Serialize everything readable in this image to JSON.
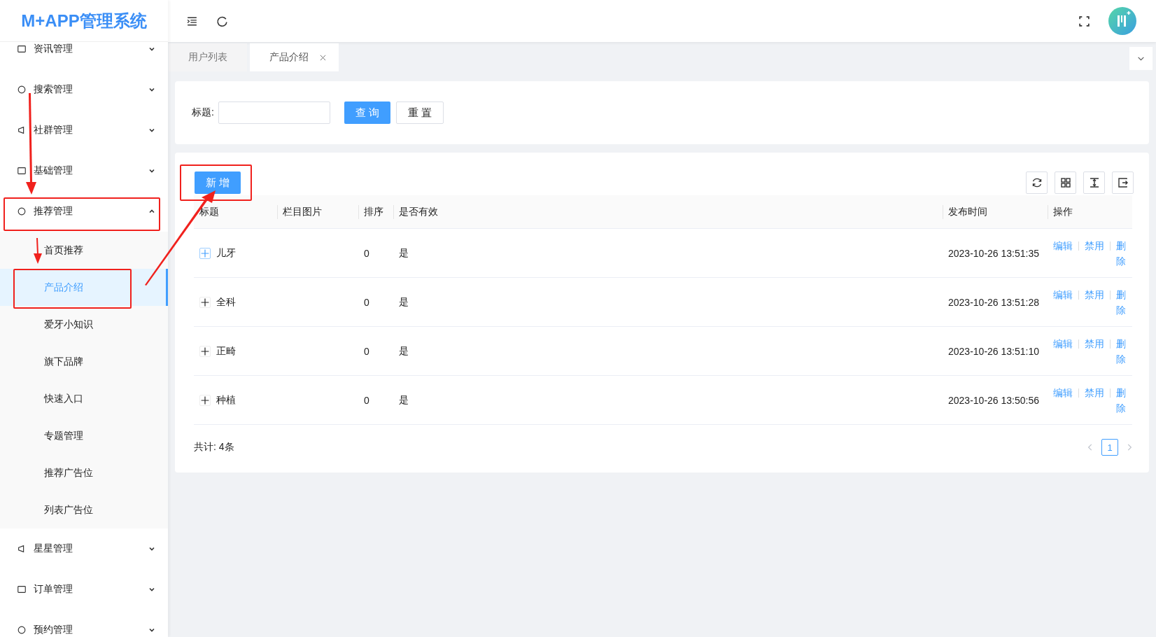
{
  "app": {
    "title": "M+APP管理系统"
  },
  "sidebar": {
    "items": [
      {
        "label": "资讯管理",
        "expanded": false
      },
      {
        "label": "搜索管理",
        "expanded": false
      },
      {
        "label": "社群管理",
        "expanded": false
      },
      {
        "label": "基础管理",
        "expanded": false
      },
      {
        "label": "推荐管理",
        "expanded": true,
        "children": [
          {
            "label": "首页推荐",
            "selected": false
          },
          {
            "label": "产品介绍",
            "selected": true
          },
          {
            "label": "爱牙小知识",
            "selected": false
          },
          {
            "label": "旗下品牌",
            "selected": false
          },
          {
            "label": "快速入口",
            "selected": false
          },
          {
            "label": "专题管理",
            "selected": false
          },
          {
            "label": "推荐广告位",
            "selected": false
          },
          {
            "label": "列表广告位",
            "selected": false
          }
        ]
      },
      {
        "label": "星星管理",
        "expanded": false
      },
      {
        "label": "订单管理",
        "expanded": false
      },
      {
        "label": "预约管理",
        "expanded": false
      }
    ]
  },
  "tabs": [
    {
      "label": "用户列表",
      "selected": false,
      "closable": false
    },
    {
      "label": "产品介绍",
      "selected": true,
      "closable": true
    }
  ],
  "search": {
    "label": "标题:",
    "buttons": [
      {
        "label": "查 询",
        "kind": "primary"
      },
      {
        "label": "重 置",
        "kind": "default"
      }
    ]
  },
  "table": {
    "add_button": "新 增",
    "columns": [
      "标题",
      "栏目图片",
      "排序",
      "是否有效",
      "发布时间",
      "操作"
    ],
    "rows": [
      {
        "title": "儿牙",
        "focused": true,
        "sort": "0",
        "valid": "是",
        "time": "2023-10-26 13:51:35",
        "actions": [
          "编辑",
          "禁用",
          "删除"
        ]
      },
      {
        "title": "全科",
        "focused": false,
        "sort": "0",
        "valid": "是",
        "time": "2023-10-26 13:51:28",
        "actions": [
          "编辑",
          "禁用",
          "删除"
        ]
      },
      {
        "title": "正畸",
        "focused": false,
        "sort": "0",
        "valid": "是",
        "time": "2023-10-26 13:51:10",
        "actions": [
          "编辑",
          "禁用",
          "删除"
        ]
      },
      {
        "title": "种植",
        "focused": false,
        "sort": "0",
        "valid": "是",
        "time": "2023-10-26 13:50:56",
        "actions": [
          "编辑",
          "禁用",
          "删除"
        ]
      }
    ],
    "total": "共计: 4条",
    "pages": [
      {
        "label": "1",
        "selected": true
      }
    ]
  }
}
